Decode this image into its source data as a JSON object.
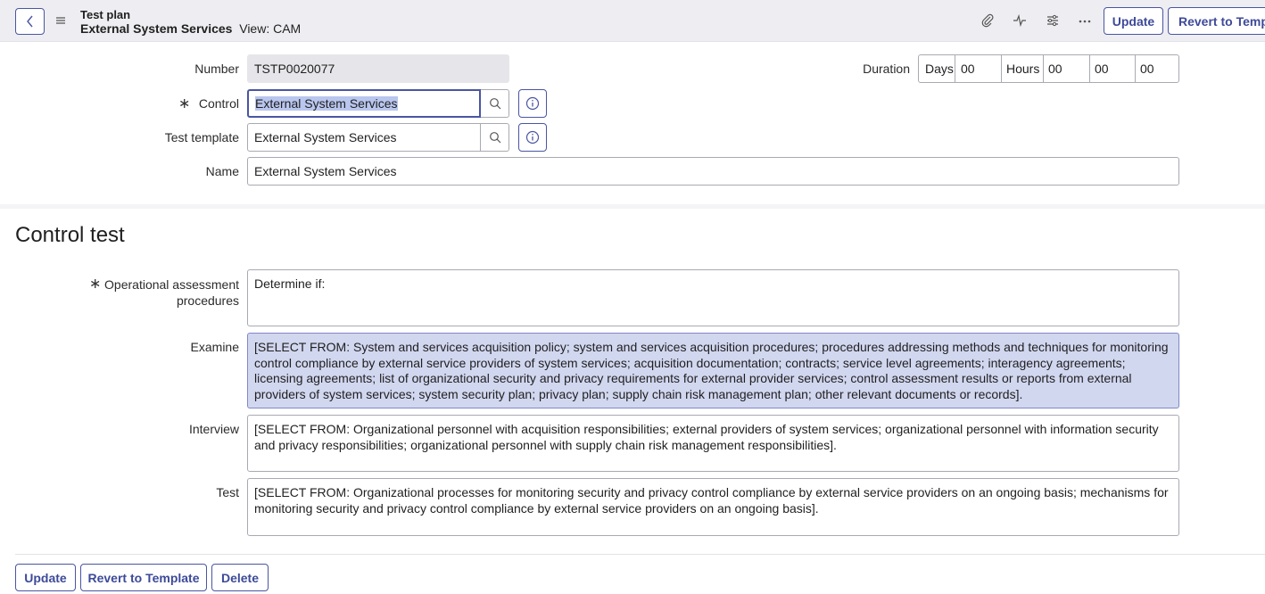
{
  "header": {
    "record_type": "Test plan",
    "record_name": "External System Services",
    "view_label": "View: CAM",
    "update_label": "Update",
    "revert_label": "Revert to Templ"
  },
  "fields": {
    "number": {
      "label": "Number",
      "value": "TSTP0020077"
    },
    "control": {
      "label": "Control",
      "value": "External System Services"
    },
    "test_template": {
      "label": "Test template",
      "value": "External System Services"
    },
    "name": {
      "label": "Name",
      "value": "External System Services"
    },
    "duration": {
      "label": "Duration",
      "days_label": "Days",
      "days_value": "00",
      "hours_label": "Hours",
      "hours_value": "00",
      "minutes_value": "00",
      "seconds_value": "00"
    }
  },
  "section": {
    "title": "Control test",
    "oap_label_line1": "Operational assessment",
    "oap_label_line2": "procedures",
    "oap_value": "Determine if:",
    "examine_label": "Examine",
    "examine_value": "[SELECT FROM: System and services acquisition policy; system and services acquisition procedures; procedures addressing methods and techniques for monitoring control compliance by external service providers of system services; acquisition documentation; contracts; service level agreements; interagency agreements; licensing agreements; list of organizational security and privacy requirements for external provider services; control assessment results or reports from external providers of system services; system security plan; privacy plan; supply chain risk management plan; other relevant documents or records].",
    "interview_label": "Interview",
    "interview_value": "[SELECT FROM: Organizational personnel with acquisition responsibilities; external providers of system services; organizational personnel with information security and privacy responsibilities; organizational personnel with supply chain risk management responsibilities].",
    "test_label": "Test",
    "test_value": "[SELECT FROM: Organizational processes for monitoring security and privacy control compliance by external service providers on an ongoing basis; mechanisms for monitoring security and privacy control compliance by external service providers on an ongoing basis]."
  },
  "footer": {
    "update_label": "Update",
    "revert_label": "Revert to Template",
    "delete_label": "Delete"
  },
  "icons": {
    "back": "chevron-left-icon",
    "menu": "hamburger-icon",
    "attachment": "paperclip-icon",
    "activity": "pulse-icon",
    "settings": "sliders-icon",
    "more": "ellipsis-icon",
    "search": "search-icon",
    "info": "info-icon"
  },
  "colors": {
    "accent": "#4a55a2",
    "header_bg": "#eeeef2",
    "highlight_bg": "#d2d7f0",
    "selection_bg": "#b9c6ee"
  }
}
